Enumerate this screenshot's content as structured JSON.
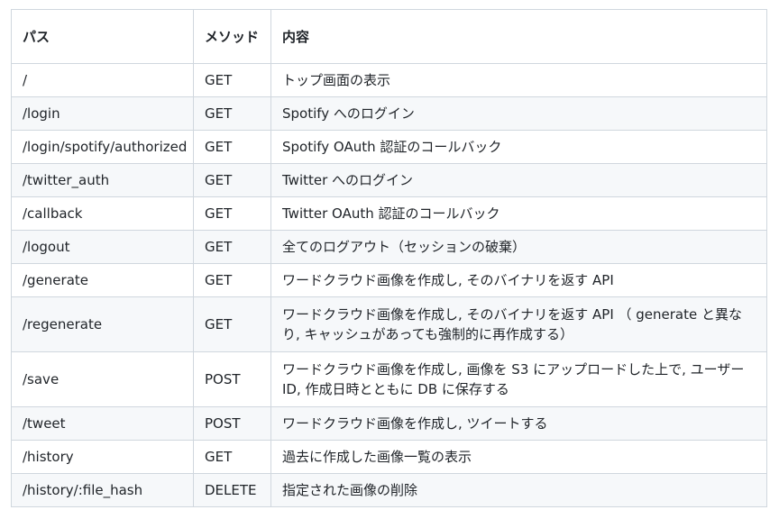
{
  "table": {
    "headers": [
      "パス",
      "メソッド",
      "内容"
    ],
    "rows": [
      {
        "path": "/",
        "method": "GET",
        "desc": "トップ画面の表示"
      },
      {
        "path": "/login",
        "method": "GET",
        "desc": "Spotify へのログイン"
      },
      {
        "path": "/login/spotify/authorized",
        "method": "GET",
        "desc": "Spotify OAuth 認証のコールバック"
      },
      {
        "path": "/twitter_auth",
        "method": "GET",
        "desc": "Twitter へのログイン"
      },
      {
        "path": "/callback",
        "method": "GET",
        "desc": "Twitter OAuth 認証のコールバック"
      },
      {
        "path": "/logout",
        "method": "GET",
        "desc": "全てのログアウト（セッションの破棄）"
      },
      {
        "path": "/generate",
        "method": "GET",
        "desc": "ワードクラウド画像を作成し, そのバイナリを返す API"
      },
      {
        "path": "/regenerate",
        "method": "GET",
        "desc": "ワードクラウド画像を作成し, そのバイナリを返す API （ generate と異なり, キャッシュがあっても強制的に再作成する）"
      },
      {
        "path": "/save",
        "method": "POST",
        "desc": "ワードクラウド画像を作成し, 画像を S3 にアップロードした上で, ユーザーID, 作成日時とともに DB に保存する"
      },
      {
        "path": "/tweet",
        "method": "POST",
        "desc": "ワードクラウド画像を作成し, ツイートする"
      },
      {
        "path": "/history",
        "method": "GET",
        "desc": "過去に作成した画像一覧の表示"
      },
      {
        "path": "/history/:file_hash",
        "method": "DELETE",
        "desc": "指定された画像の削除"
      }
    ]
  }
}
